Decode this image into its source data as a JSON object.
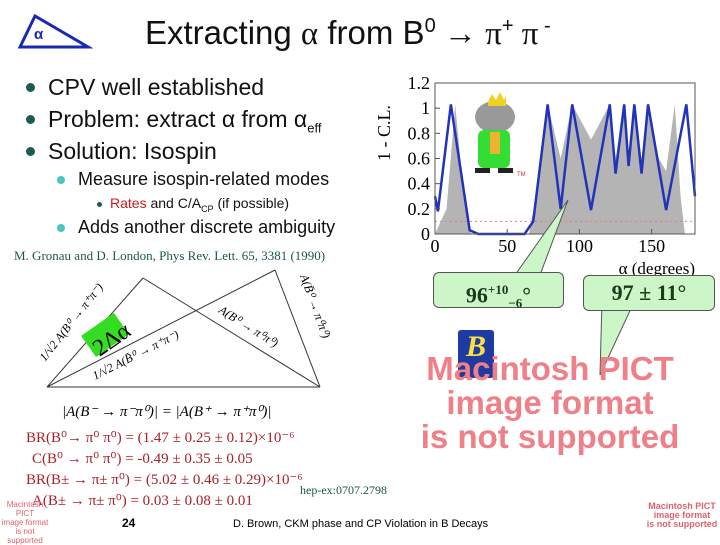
{
  "header": {
    "logo_symbol": "α",
    "title_prefix": "Extracting ",
    "alpha": "α",
    "title_mid": " from B",
    "sup0": "0",
    "title_arrow": " → π",
    "sup_plus": "+",
    "pi2": " π",
    "sup_minus": " -"
  },
  "bullets": [
    {
      "text": "CPV well established"
    },
    {
      "text": "Problem: extract α from α",
      "sub": "eff"
    },
    {
      "text": "Solution: Isospin"
    }
  ],
  "sub_bullets": [
    {
      "text": "Measure isospin-related modes"
    },
    {
      "text": "Adds another discrete ambiguity"
    }
  ],
  "sub_sub": {
    "red": "Rates",
    "rest": " and C/A",
    "sub": "CP",
    "tail": " (if possible)"
  },
  "reference": "M. Gronau and D. London, Phys Rev. Lett. 65, 3381 (1990)",
  "diagram": {
    "labels": [
      "1/√2 A(B⁰ → π⁺π⁻)",
      "1/√2 A(B̄⁰ → π⁺π⁻)",
      "A(B⁰ → π⁰π⁰)",
      "A(B̄⁰ → π⁰π⁰)",
      "|A(B⁻ → π⁻π⁰)| = |A(B⁺ → π⁺π⁰)|"
    ],
    "angle_label": "2Δα",
    "angle_color": "#33dd22"
  },
  "results": [
    "BR(B⁰→ π⁰ π⁰) = (1.47 ± 0.25 ± 0.12)×10⁻⁶",
    "C(B⁰ → π⁰ π⁰) = -0.49 ± 0.35 ± 0.05",
    "BR(B± → π± π⁰) = (5.02 ± 0.46 ± 0.29)×10⁻⁶",
    "A(B± → π± π⁰) = 0.03 ± 0.08 ± 0.01"
  ],
  "hep_ref": "hep-ex:0707.2798",
  "callouts": {
    "left_main": "96",
    "left_sup": "+10",
    "left_sub": "−6",
    "left_deg": "°",
    "right": "97 ± 11°"
  },
  "pict_large": [
    "Macintosh PICT",
    "image format",
    "is not supported"
  ],
  "pict_small": [
    "Macintosh PICT",
    "image format",
    "is not supported"
  ],
  "footer": {
    "page": "24",
    "text": "D. Brown, CKM phase and CP Violation in B Decays"
  },
  "chart_data": {
    "type": "line",
    "ylabel": "1 - C.L.",
    "xlabel": "α (degrees)",
    "xlim": [
      0,
      180
    ],
    "ylim": [
      0,
      1.2
    ],
    "xticks": [
      "0",
      "50",
      "100",
      "150"
    ],
    "yticks": [
      "0",
      "0.2",
      "0.4",
      "0.6",
      "0.8",
      "1",
      "1.2"
    ],
    "series": [
      {
        "style": "blue-line",
        "color": "#2233bb",
        "x": [
          0,
          2,
          11,
          24,
          30,
          62,
          68,
          78,
          87,
          95,
          108,
          121,
          125,
          131,
          134,
          138,
          143,
          147.5,
          160,
          174,
          180
        ],
        "y": [
          0.3,
          0.18,
          1.03,
          0.03,
          0,
          0,
          0.1,
          1.03,
          0.2,
          1.03,
          0.19,
          1.03,
          0.48,
          1.03,
          0.54,
          1.03,
          0.48,
          1.03,
          0.19,
          1.03,
          0.3
        ]
      },
      {
        "style": "grey-area",
        "color": "#b4b4b4",
        "x": [
          0,
          8,
          14,
          20,
          25,
          65,
          70,
          78,
          87,
          95,
          108,
          121,
          125,
          131,
          134,
          138,
          143,
          147,
          155,
          160,
          166,
          170,
          173,
          180
        ],
        "y": [
          0,
          0.2,
          1.03,
          0.3,
          0,
          0,
          0.3,
          1.03,
          0.6,
          1.03,
          0.75,
          1.03,
          0.6,
          1.03,
          0.6,
          1.03,
          0.6,
          1.03,
          0.6,
          0.5,
          1.03,
          0.3,
          0,
          0
        ]
      }
    ],
    "reference_line": {
      "y": 0.1,
      "color": "#e08080",
      "style": "dotted"
    },
    "grid": false,
    "mascot": "elephant-mascot",
    "mascot_mark": "TM"
  }
}
